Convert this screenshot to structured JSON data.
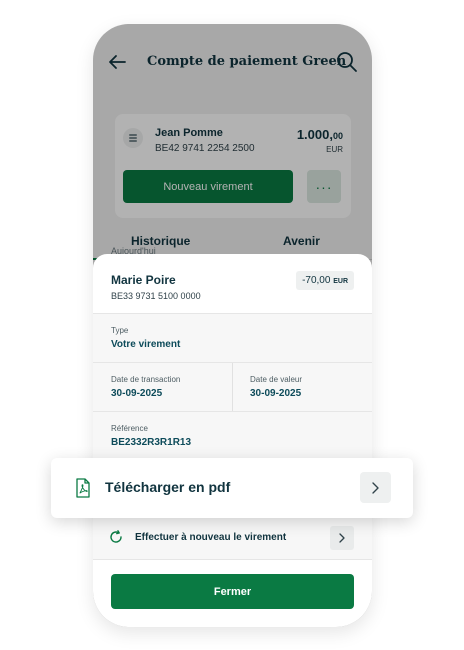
{
  "header": {
    "title": "Compte de paiement Green"
  },
  "account": {
    "name": "Jean Pomme",
    "iban": "BE42 9741 2254 2500",
    "amount_main": "1.000,",
    "amount_cents": "00",
    "currency": "EUR",
    "new_transfer_label": "Nouveau virement",
    "more_label": "···"
  },
  "tabs": [
    {
      "label": "Historique",
      "active": true
    },
    {
      "label": "Avenir",
      "active": false
    }
  ],
  "list": {
    "date_header": "Aujourd'hui"
  },
  "transaction": {
    "name": "Marie Poire",
    "iban": "BE33 9731 5100 0000",
    "amount": "-70,00",
    "currency": "EUR",
    "type_label": "Type",
    "type_value": "Votre virement",
    "transaction_date_label": "Date de transaction",
    "transaction_date_value": "30-09-2025",
    "value_date_label": "Date de valeur",
    "value_date_value": "30-09-2025",
    "reference_label": "Référence",
    "reference_value": "BE2332R3R1R13"
  },
  "actions": {
    "download_pdf_label": "Télécharger en pdf",
    "redo_transfer_label": "Effectuer à nouveau le virement",
    "close_label": "Fermer"
  },
  "colors": {
    "primary_green": "#0a7a43",
    "text_dark": "#11343f",
    "value_teal": "#0d4b5a"
  }
}
